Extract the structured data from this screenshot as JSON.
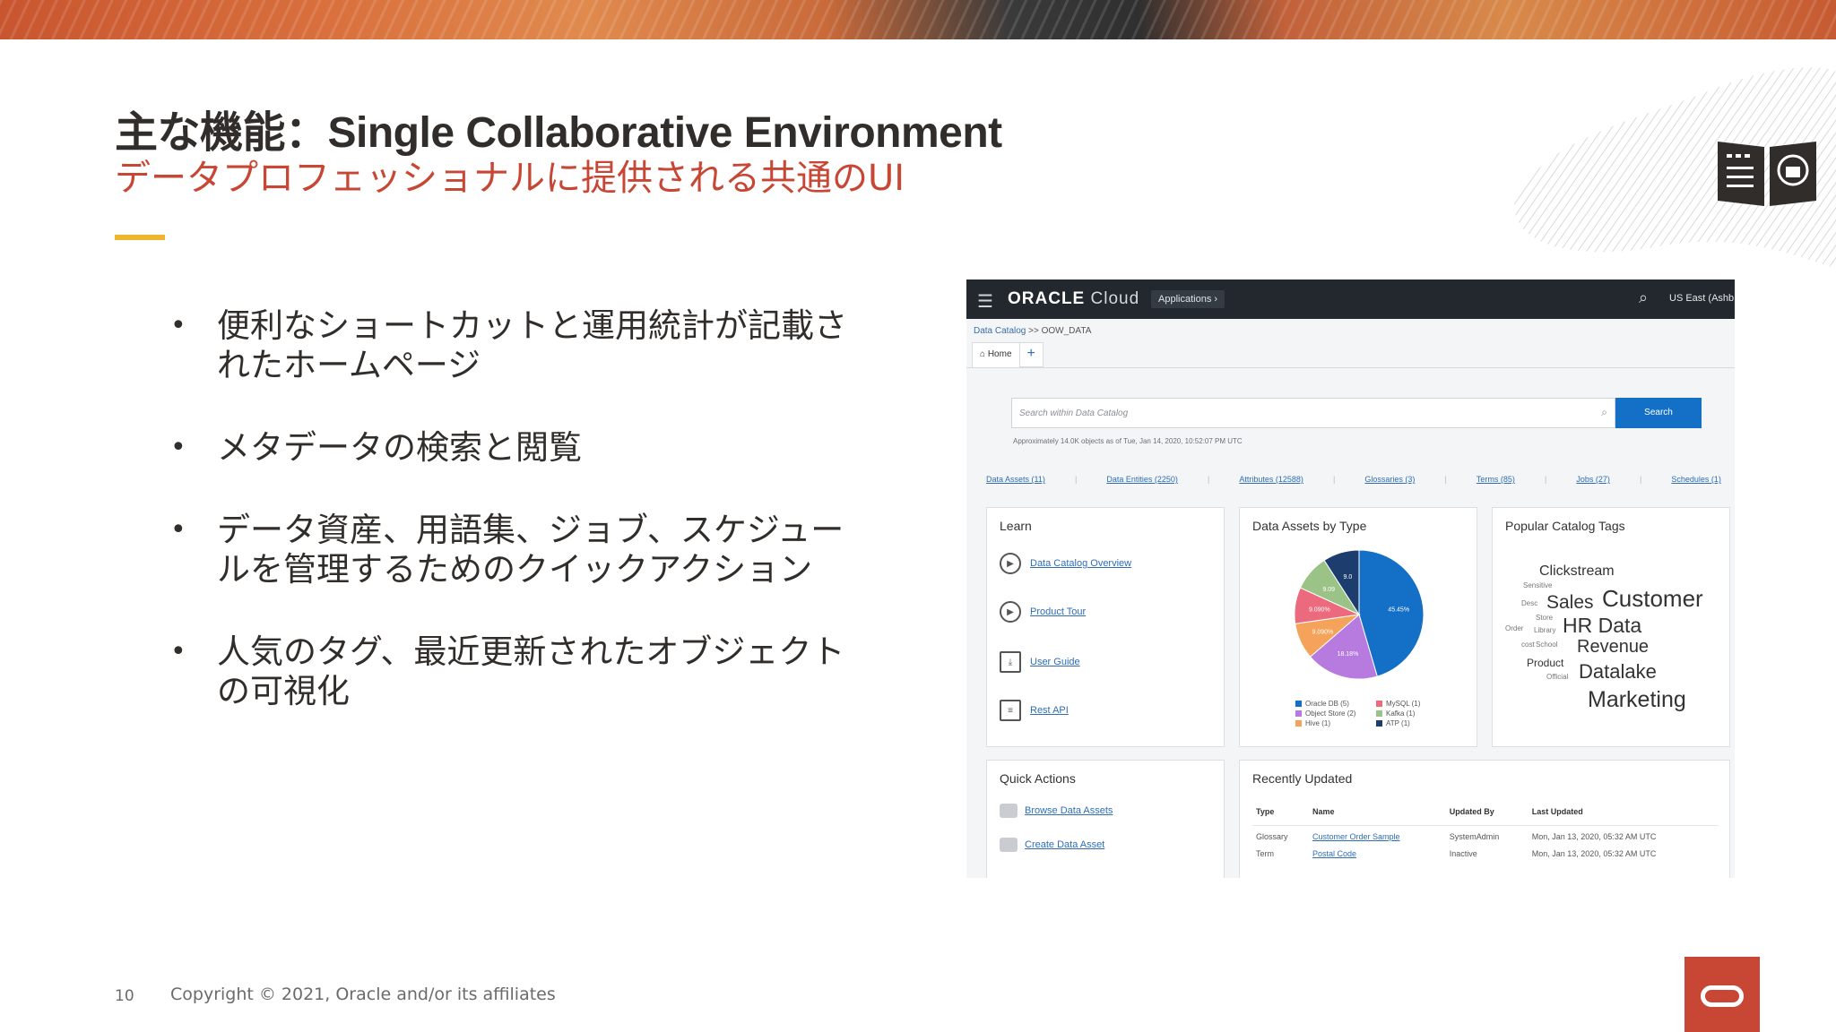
{
  "slide": {
    "title": "主な機能：Single Collaborative Environment",
    "subtitle": "データプロフェッショナルに提供される共通のUI",
    "bullets": [
      "便利なショートカットと運用統計が記載されたホームページ",
      "メタデータの検索と閲覧",
      "データ資産、用語集、ジョブ、スケジュールを管理するためのクイックアクション",
      "人気のタグ、最近更新されたオブジェクトの可視化"
    ],
    "page_number": "10",
    "copyright": "Copyright © 2021, Oracle and/or its affiliates",
    "colors": {
      "title": "#312d2a",
      "subtitle": "#c74634",
      "accent": "#f0b52e",
      "badge": "#c74634"
    }
  },
  "app": {
    "brand": "ORACLE",
    "brand_suffix": "Cloud",
    "applications": "Applications",
    "region": "US East (Ashb",
    "breadcrumb_root": "Data Catalog",
    "breadcrumb_sep": ">>",
    "breadcrumb_current": "OOW_DATA",
    "tab_home": "Home",
    "search_placeholder": "Search within Data Catalog",
    "search_button": "Search",
    "approx_text": "Approximately 14.0K objects as of Tue, Jan 14, 2020, 10:52:07 PM UTC",
    "counts": [
      "Data Assets (11)",
      "Data Entities (2250)",
      "Attributes (12588)",
      "Glossaries (3)",
      "Terms (85)",
      "Jobs (27)",
      "Schedules (1)"
    ],
    "learn": {
      "title": "Learn",
      "items": [
        "Data Catalog Overview",
        "Product Tour",
        "User Guide",
        "Rest API"
      ]
    },
    "assets_by_type": {
      "title": "Data Assets by Type"
    },
    "catalog_tags": {
      "title": "Popular Catalog Tags",
      "tags": [
        "Clickstream",
        "Sensitive",
        "Desc",
        "Sales",
        "Customer",
        "Store",
        "Order",
        "Library",
        "HR Data",
        "cost",
        "School",
        "Revenue",
        "Product",
        "Official",
        "Datalake",
        "Marketing"
      ]
    },
    "quick_actions": {
      "title": "Quick Actions",
      "items": [
        "Browse Data Assets",
        "Create Data Asset"
      ]
    },
    "recently_updated": {
      "title": "Recently Updated",
      "columns": [
        "Type",
        "Name",
        "Updated By",
        "Last Updated"
      ],
      "rows": [
        [
          "Glossary",
          "Customer Order Sample",
          "SystemAdmin",
          "Mon, Jan 13, 2020, 05:32 AM UTC"
        ],
        [
          "Term",
          "Postal Code",
          "Inactive",
          "Mon, Jan 13, 2020, 05:32 AM UTC"
        ]
      ]
    }
  },
  "chart_data": {
    "type": "pie",
    "title": "Data Assets by Type",
    "slices": [
      {
        "label": "Oracle DB (5)",
        "value": 45.45,
        "text": "45.45%",
        "color": "#1470c7"
      },
      {
        "label": "Object Store (2)",
        "value": 18.18,
        "text": "18.18%",
        "color": "#b77be0"
      },
      {
        "label": "Hive (1)",
        "value": 9.09,
        "text": "9.090%",
        "color": "#f5a35a"
      },
      {
        "label": "MySQL (1)",
        "value": 9.09,
        "text": "9.090%",
        "color": "#ec6a7e"
      },
      {
        "label": "Kafka (1)",
        "value": 9.09,
        "text": "9.09",
        "color": "#9bc388"
      },
      {
        "label": "ATP (1)",
        "value": 9.09,
        "text": "9.0",
        "color": "#1d3d6e"
      }
    ],
    "legend": [
      "Oracle DB (5)",
      "MySQL (1)",
      "Object Store (2)",
      "Kafka (1)",
      "Hive (1)",
      "ATP (1)"
    ]
  }
}
